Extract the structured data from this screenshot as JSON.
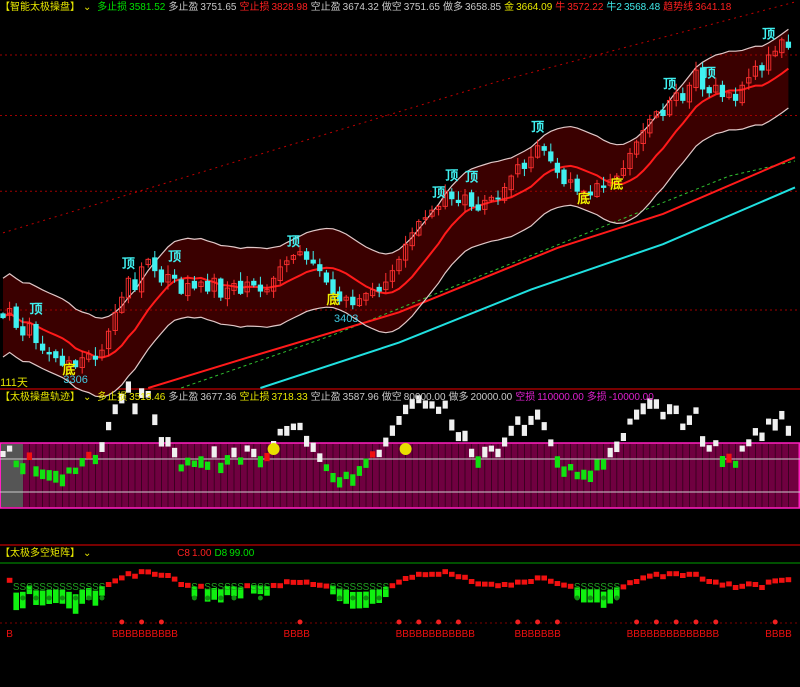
{
  "panel1": {
    "title": "【智能太极操盘】",
    "items": [
      {
        "k": "多止损",
        "v": "3581.52",
        "kc": "g",
        "vc": "g"
      },
      {
        "k": "多止盈",
        "v": "3751.65",
        "kc": "w",
        "vc": "w"
      },
      {
        "k": "空止损",
        "v": "3828.98",
        "kc": "r",
        "vc": "r"
      },
      {
        "k": "空止盈",
        "v": "3674.32",
        "kc": "w",
        "vc": "w"
      },
      {
        "k": "做空",
        "v": "3751.65",
        "kc": "w",
        "vc": "w"
      },
      {
        "k": "做多",
        "v": "3658.85",
        "kc": "w",
        "vc": "w"
      },
      {
        "k": "金",
        "v": "3664.09",
        "kc": "y",
        "vc": "y"
      },
      {
        "k": "牛",
        "v": "3572.22",
        "kc": "r",
        "vc": "r"
      },
      {
        "k": "牛2",
        "v": "3568.48",
        "kc": "c",
        "vc": "c"
      },
      {
        "k": "趋势线",
        "v": "3641.18",
        "kc": "r",
        "vc": "r"
      }
    ],
    "days_label": "111天"
  },
  "panel2": {
    "title": "【太极操盘轨迹】",
    "items": [
      {
        "k": "多止损",
        "v": "3513.46",
        "kc": "y",
        "vc": "y"
      },
      {
        "k": "多止盈",
        "v": "3677.36",
        "kc": "w",
        "vc": "w"
      },
      {
        "k": "空止损",
        "v": "3718.33",
        "kc": "y",
        "vc": "y"
      },
      {
        "k": "空止盈",
        "v": "3587.96",
        "kc": "w",
        "vc": "w"
      },
      {
        "k": "做空",
        "v": "80000.00",
        "kc": "w",
        "vc": "w"
      },
      {
        "k": "做多",
        "v": "20000.00",
        "kc": "w",
        "vc": "w"
      },
      {
        "k": "空损",
        "v": "110000.00",
        "kc": "m",
        "vc": "m"
      },
      {
        "k": "多损",
        "v": "-10000.00",
        "kc": "m",
        "vc": "m"
      }
    ]
  },
  "panel3": {
    "title": "【太极多空矩阵】",
    "items": [
      {
        "k": "C8",
        "v": "1.00",
        "kc": "r",
        "vc": "r"
      },
      {
        "k": "D8",
        "v": "99.00",
        "kc": "g",
        "vc": "g"
      }
    ],
    "sell_letter": "S",
    "buy_letter": "B"
  },
  "colors": {
    "up": "#ff3030",
    "down": "#40f0f0",
    "channel": "#3a0000",
    "band": "#e0c8c8",
    "ma": "#ff1a1a",
    "cyan": "#20e0e0",
    "green": "#30c030",
    "magenta": "#ff20c0",
    "bar_bg": "#700040"
  },
  "chart_data": {
    "type": "candlestick",
    "ylim": [
      3300,
      3810
    ],
    "close": [
      3393,
      3405,
      3380,
      3370,
      3385,
      3360,
      3350,
      3345,
      3340,
      3330,
      3336,
      3328,
      3340,
      3345,
      3338,
      3350,
      3375,
      3400,
      3420,
      3445,
      3430,
      3460,
      3470,
      3455,
      3440,
      3450,
      3445,
      3425,
      3438,
      3432,
      3440,
      3428,
      3445,
      3420,
      3432,
      3438,
      3425,
      3440,
      3436,
      3428,
      3430,
      3445,
      3460,
      3468,
      3475,
      3480,
      3470,
      3465,
      3455,
      3440,
      3425,
      3415,
      3420,
      3410,
      3418,
      3425,
      3430,
      3428,
      3440,
      3455,
      3470,
      3490,
      3505,
      3520,
      3525,
      3535,
      3540,
      3560,
      3550,
      3545,
      3555,
      3540,
      3535,
      3548,
      3552,
      3550,
      3565,
      3580,
      3595,
      3590,
      3605,
      3620,
      3614,
      3600,
      3585,
      3570,
      3575,
      3560,
      3560,
      3555,
      3570,
      3565,
      3575,
      3580,
      3590,
      3610,
      3625,
      3640,
      3655,
      3665,
      3660,
      3680,
      3690,
      3680,
      3700,
      3720,
      3695,
      3690,
      3700,
      3685,
      3690,
      3680,
      3700,
      3710,
      3725,
      3720,
      3740,
      3745,
      3760,
      3750
    ],
    "lines": {
      "slow_red": [
        [
          22,
          3300
        ],
        [
          37,
          3340
        ],
        [
          60,
          3400
        ],
        [
          84,
          3485
        ],
        [
          100,
          3530
        ],
        [
          120,
          3605
        ]
      ],
      "cyan": [
        [
          39,
          3300
        ],
        [
          60,
          3360
        ],
        [
          80,
          3430
        ],
        [
          100,
          3490
        ],
        [
          120,
          3565
        ]
      ],
      "green_dashed": [
        [
          27,
          3300
        ],
        [
          50,
          3370
        ],
        [
          70,
          3440
        ],
        [
          90,
          3510
        ],
        [
          110,
          3580
        ],
        [
          120,
          3600
        ]
      ],
      "red_dotted": [
        [
          0,
          3505
        ],
        [
          75,
          3705
        ],
        [
          120,
          3810
        ]
      ]
    },
    "gridlines": [
      3740,
      3660,
      3560,
      3403
    ],
    "tops": [
      5,
      19,
      26,
      44,
      66,
      68,
      71,
      81,
      101,
      107,
      116
    ],
    "bottoms": [
      10,
      50,
      88,
      93
    ],
    "top_label": "顶",
    "bottom_label": "底",
    "lows": [
      {
        "index": 11,
        "value": "3306"
      },
      {
        "index": 52,
        "value": "3403"
      }
    ]
  }
}
